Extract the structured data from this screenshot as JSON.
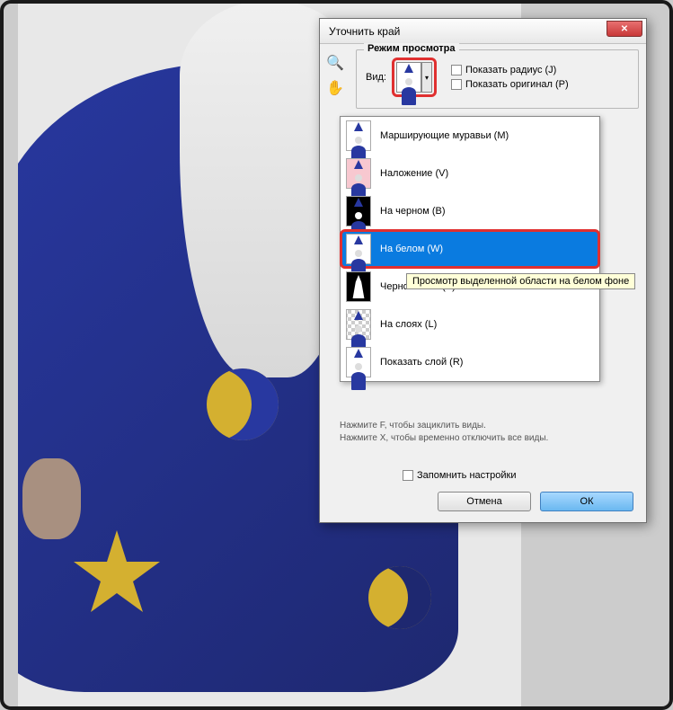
{
  "dialog": {
    "title": "Уточнить край",
    "fieldset_legend": "Режим просмотра",
    "view_label": "Вид:",
    "checkboxes": {
      "show_radius": "Показать радиус (J)",
      "show_original": "Показать оригинал (P)"
    },
    "dropdown_items": [
      {
        "label": "Марширующие муравьи (M)",
        "thumb": "white"
      },
      {
        "label": "Наложение (V)",
        "thumb": "pink"
      },
      {
        "label": "На черном (B)",
        "thumb": "black"
      },
      {
        "label": "На белом (W)",
        "thumb": "white",
        "selected": true
      },
      {
        "label": "Черно-белое (K)",
        "thumb": "bw"
      },
      {
        "label": "На слоях (L)",
        "thumb": "checker"
      },
      {
        "label": "Показать слой (R)",
        "thumb": "white"
      }
    ],
    "tooltip": "Просмотр выделенной области на белом фоне",
    "hint_line1": "Нажмите F, чтобы зациклить виды.",
    "hint_line2": "Нажмите X, чтобы временно отключить все виды.",
    "remember": "Запомнить настройки",
    "buttons": {
      "cancel": "Отмена",
      "ok": "ОК"
    }
  },
  "icons": {
    "zoom": "🔍",
    "hand": "✋",
    "close": "✕",
    "arrow": "▾"
  }
}
